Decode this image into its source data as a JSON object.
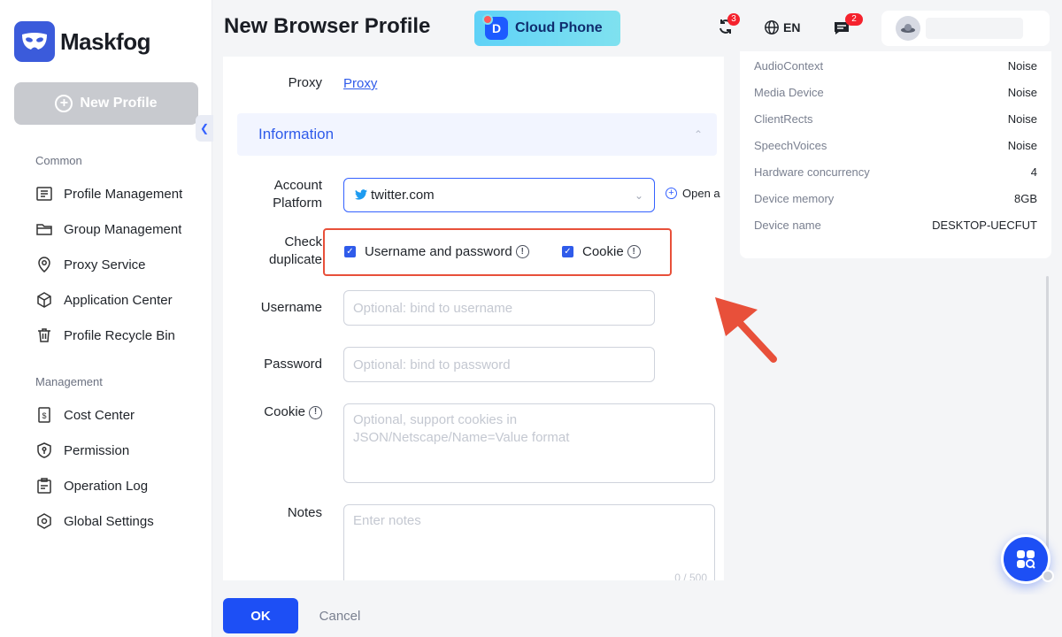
{
  "app": {
    "name": "Maskfog"
  },
  "sidebar": {
    "new_profile": "New Profile",
    "sections": [
      {
        "title": "Common",
        "items": [
          {
            "label": "Profile Management",
            "icon": "profile-list-icon"
          },
          {
            "label": "Group Management",
            "icon": "folder-icon"
          },
          {
            "label": "Proxy Service",
            "icon": "location-pin-icon"
          },
          {
            "label": "Application Center",
            "icon": "cube-icon"
          },
          {
            "label": "Profile Recycle Bin",
            "icon": "trash-icon"
          }
        ]
      },
      {
        "title": "Management",
        "items": [
          {
            "label": "Cost Center",
            "icon": "dollar-icon"
          },
          {
            "label": "Permission",
            "icon": "shield-key-icon"
          },
          {
            "label": "Operation Log",
            "icon": "clipboard-icon"
          },
          {
            "label": "Global Settings",
            "icon": "hexagon-gear-icon"
          }
        ]
      }
    ]
  },
  "header": {
    "title": "New Browser Profile",
    "cloud_phone": "Cloud Phone",
    "sync_badge": "3",
    "language": "EN",
    "messages_badge": "2"
  },
  "form": {
    "proxy_label": "Proxy",
    "proxy_link": "Proxy",
    "section_information": "Information",
    "account_platform_label_1": "Account",
    "account_platform_label_2": "Platform",
    "account_platform_value": "twitter.com",
    "open_link": "Open a",
    "check_duplicate_label_1": "Check",
    "check_duplicate_label_2": "duplicate",
    "check_username_password": "Username and password",
    "check_cookie": "Cookie",
    "username_label": "Username",
    "username_placeholder": "Optional: bind to username",
    "password_label": "Password",
    "password_placeholder": "Optional: bind to password",
    "cookie_label": "Cookie",
    "cookie_placeholder_1": "Optional, support cookies in",
    "cookie_placeholder_2": "JSON/Netscape/Name=Value format",
    "notes_label": "Notes",
    "notes_placeholder": "Enter notes",
    "notes_counter": "0 / 500"
  },
  "fingerprint": [
    {
      "key": "AudioContext",
      "value": "Noise"
    },
    {
      "key": "Media Device",
      "value": "Noise"
    },
    {
      "key": "ClientRects",
      "value": "Noise"
    },
    {
      "key": "SpeechVoices",
      "value": "Noise"
    },
    {
      "key": "Hardware concurrency",
      "value": "4"
    },
    {
      "key": "Device memory",
      "value": "8GB"
    },
    {
      "key": "Device name",
      "value": "DESKTOP-UECFUT"
    }
  ],
  "footer": {
    "ok": "OK",
    "cancel": "Cancel"
  },
  "colors": {
    "primary": "#1d4ff5",
    "link": "#2f5bea",
    "highlight": "#e8503a"
  }
}
